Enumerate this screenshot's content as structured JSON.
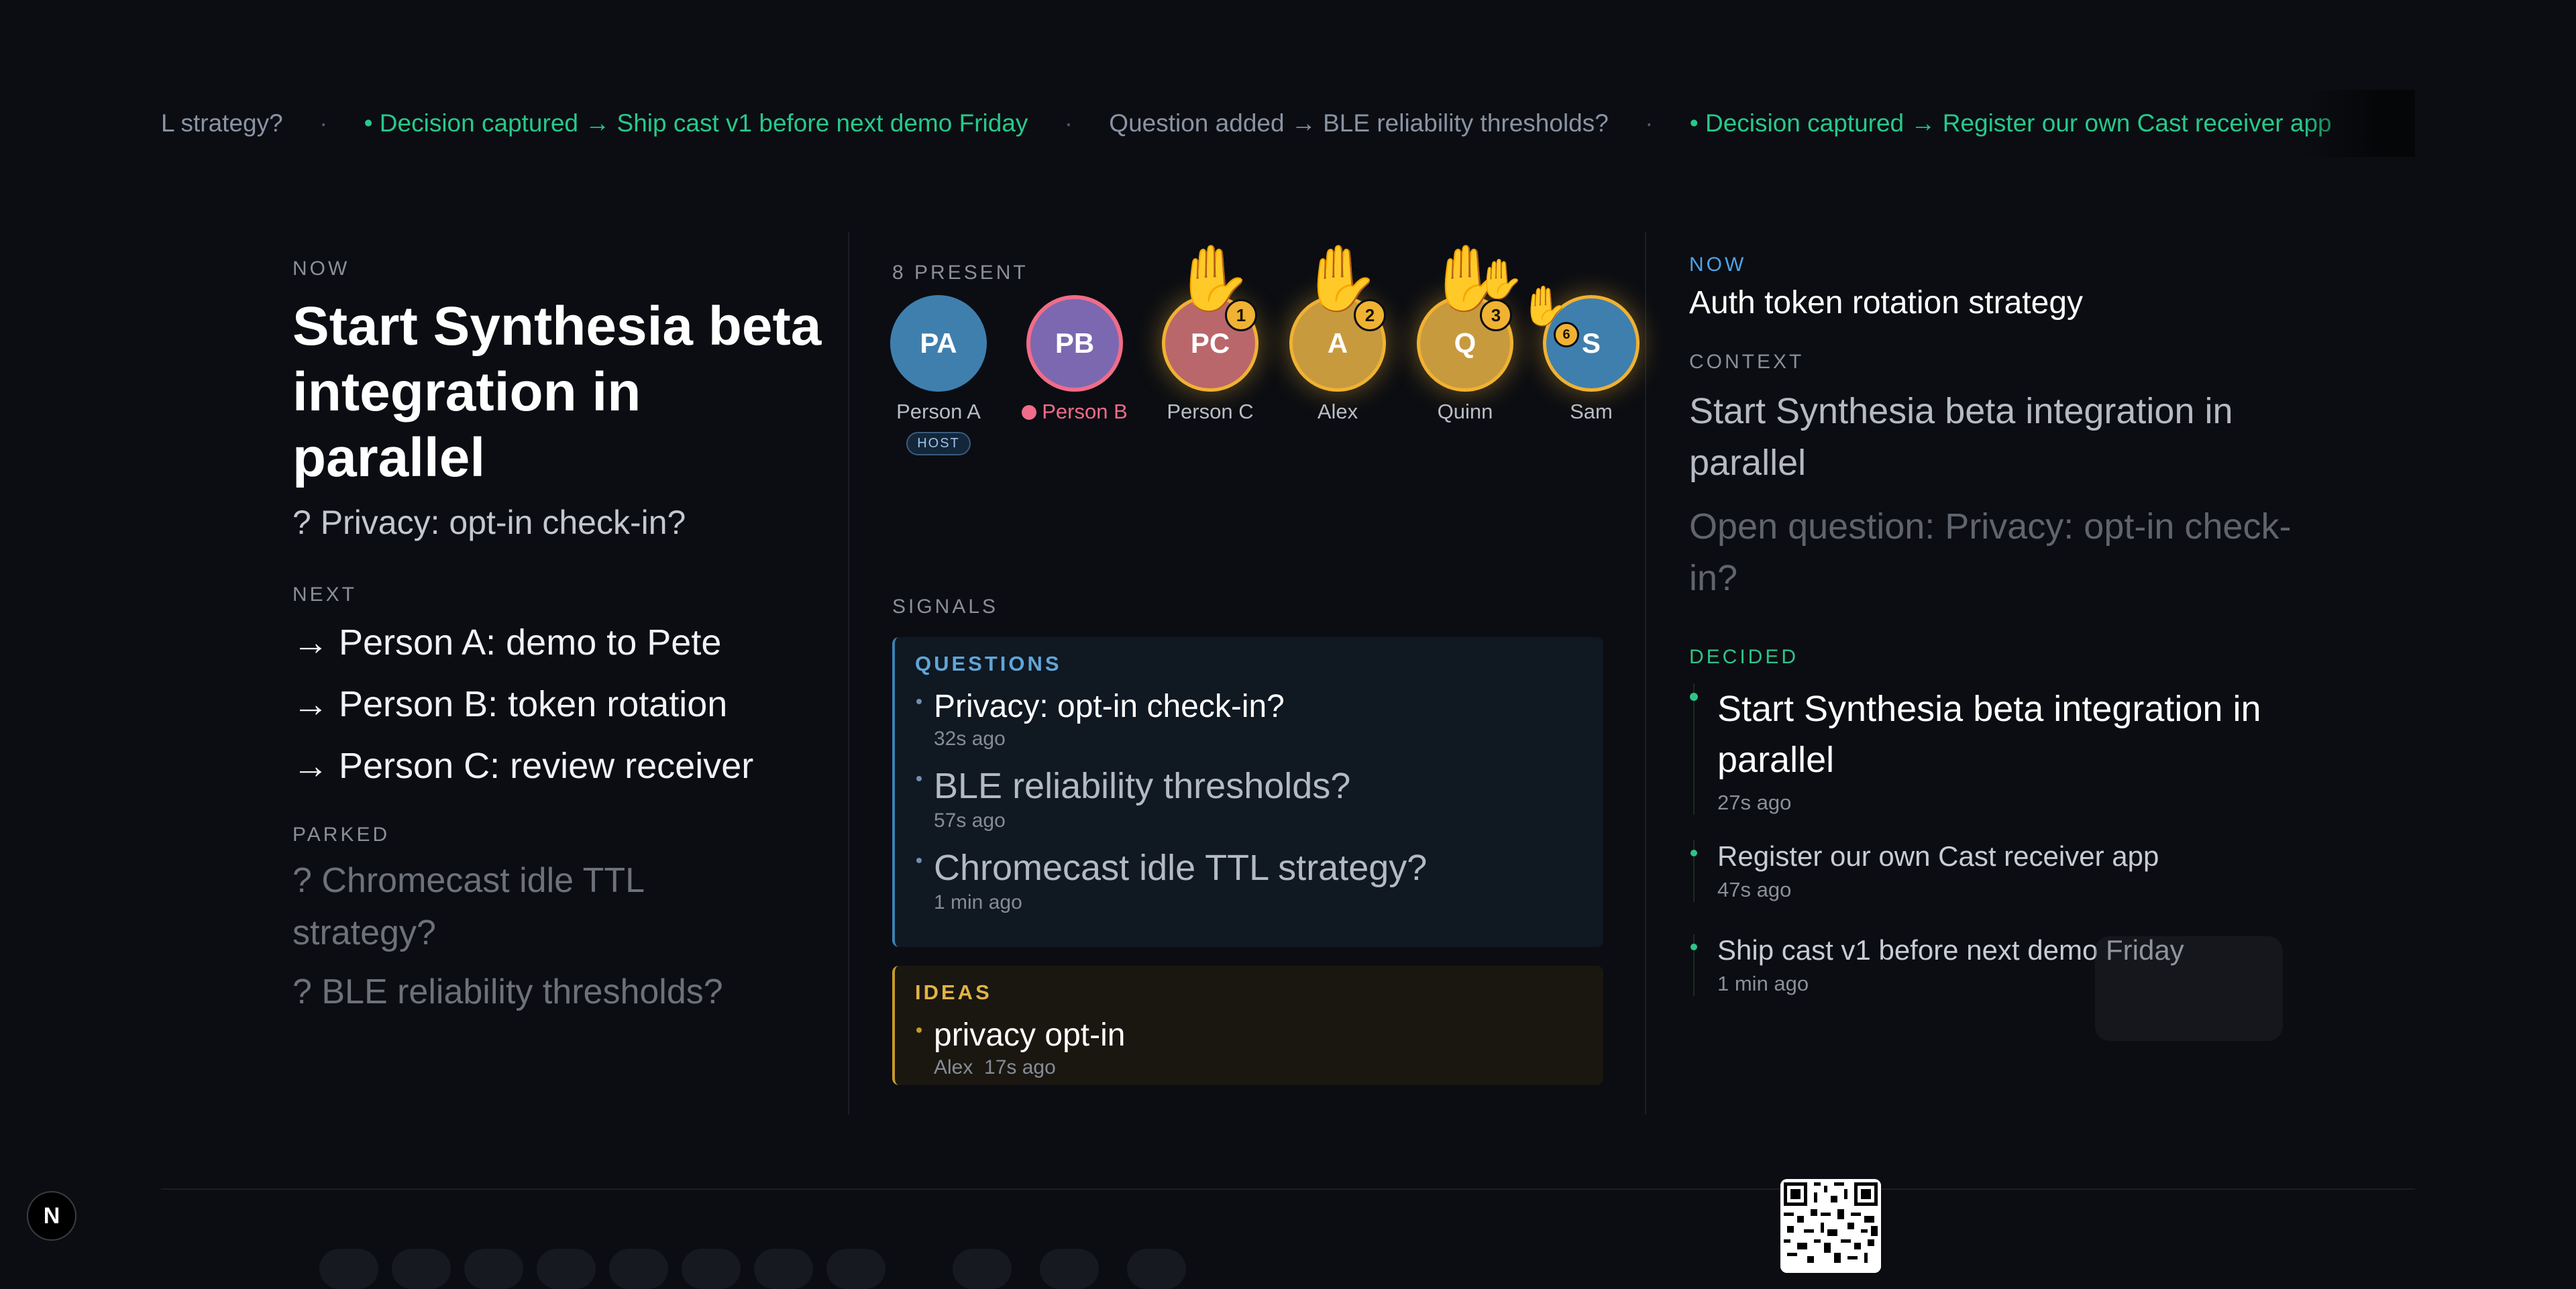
{
  "ticker": {
    "items": [
      {
        "text": "L strategy?",
        "kind": "question"
      },
      {
        "text": "• Decision captured → Ship cast v1 before next demo Friday",
        "kind": "decision"
      },
      {
        "text": "Question added → BLE reliability thresholds?",
        "kind": "question"
      },
      {
        "text": "• Decision captured → Register our own Cast receiver app",
        "kind": "decision"
      }
    ],
    "separator": "·"
  },
  "left": {
    "now_label": "NOW",
    "now_title": "Start Synthesia beta integration in parallel",
    "now_question": "? Privacy: opt-in check-in?",
    "next_label": "NEXT",
    "next_items": [
      "→ Person A: demo to Pete",
      "→ Person B: token rotation",
      "→ Person C: review receiver"
    ],
    "parked_label": "PARKED",
    "parked_items": [
      "? Chromecast idle TTL strategy?",
      "? BLE reliability thresholds?"
    ]
  },
  "presence": {
    "label": "8 PRESENT",
    "people": [
      {
        "initials": "PA",
        "name": "Person A",
        "badge": "HOST",
        "color": "#3f7fae"
      },
      {
        "initials": "PB",
        "name": "Person B",
        "color": "#7b68b0",
        "speaking": true
      },
      {
        "initials": "PC",
        "name": "Person C",
        "color": "#b9676b",
        "hand": "1"
      },
      {
        "initials": "A",
        "name": "Alex",
        "color": "#c89a3e",
        "hand": "2"
      },
      {
        "initials": "Q",
        "name": "Quinn",
        "color": "#c89a3e",
        "hand": "3"
      },
      {
        "initials": "S",
        "name": "Sam",
        "color": "#3f7fae",
        "hand": "6"
      }
    ],
    "hand_icon": "✋"
  },
  "signals": {
    "label": "SIGNALS",
    "questions_title": "QUESTIONS",
    "questions": [
      {
        "text": "Privacy: opt-in check-in?",
        "time": "32s ago"
      },
      {
        "text": "BLE reliability thresholds?",
        "time": "57s ago"
      },
      {
        "text": "Chromecast idle TTL strategy?",
        "time": "1 min ago"
      }
    ],
    "ideas_title": "IDEAS",
    "ideas": [
      {
        "text": "privacy opt-in",
        "author": "Alex",
        "time": "17s ago"
      }
    ]
  },
  "right": {
    "now_label": "NOW",
    "now_text": "Auth token rotation strategy",
    "context_label": "CONTEXT",
    "context_text": "Start Synthesia beta integration in parallel",
    "open_question": "Open question: Privacy: opt-in check-in?",
    "decided_label": "DECIDED",
    "decided": [
      {
        "text": "Start Synthesia beta integration in parallel",
        "time": "27s ago"
      },
      {
        "text": "Register our own Cast receiver app",
        "time": "47s ago"
      },
      {
        "text": "Ship cast v1 before next demo Friday",
        "time": "1 min ago"
      }
    ]
  },
  "bottom": {
    "dev_badge": "N"
  },
  "colors": {
    "decision": "#27c98a",
    "question_accent": "#3b82b3",
    "idea_accent": "#c79a2a",
    "hand": "#f0b232"
  }
}
